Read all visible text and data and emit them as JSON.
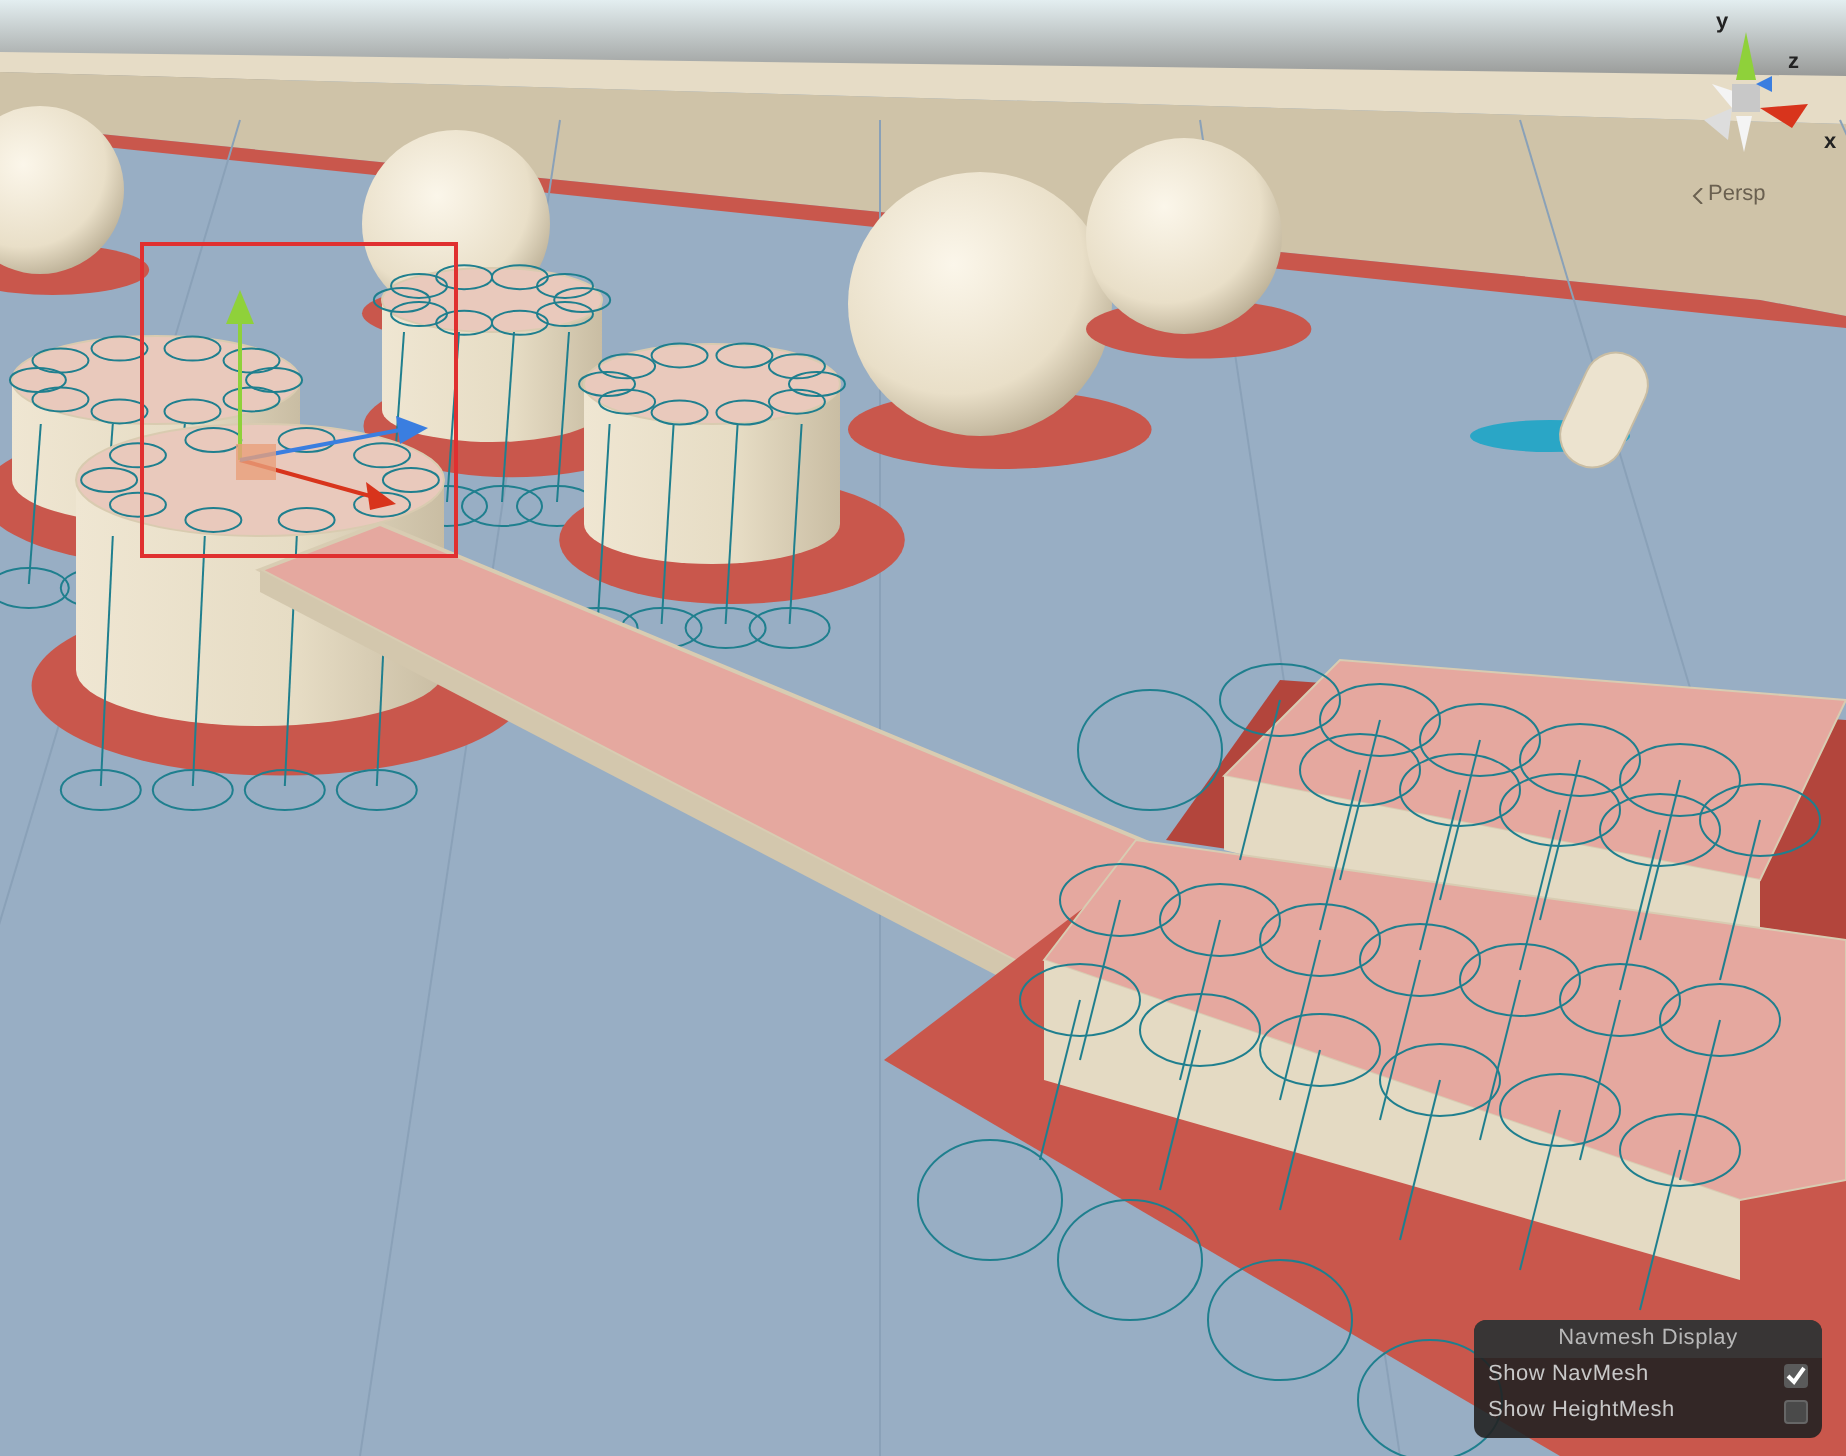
{
  "scene_gizmo": {
    "axes": [
      {
        "label": "y",
        "color": "#8fd13a"
      },
      {
        "label": "z",
        "color": "#3a7ee0"
      },
      {
        "label": "x",
        "color": "#d8341c"
      }
    ],
    "projection": "Persp"
  },
  "navmesh_display": {
    "title": "Navmesh Display",
    "options": [
      {
        "label": "Show NavMesh",
        "checked": true
      },
      {
        "label": "Show HeightMesh",
        "checked": false
      }
    ]
  }
}
